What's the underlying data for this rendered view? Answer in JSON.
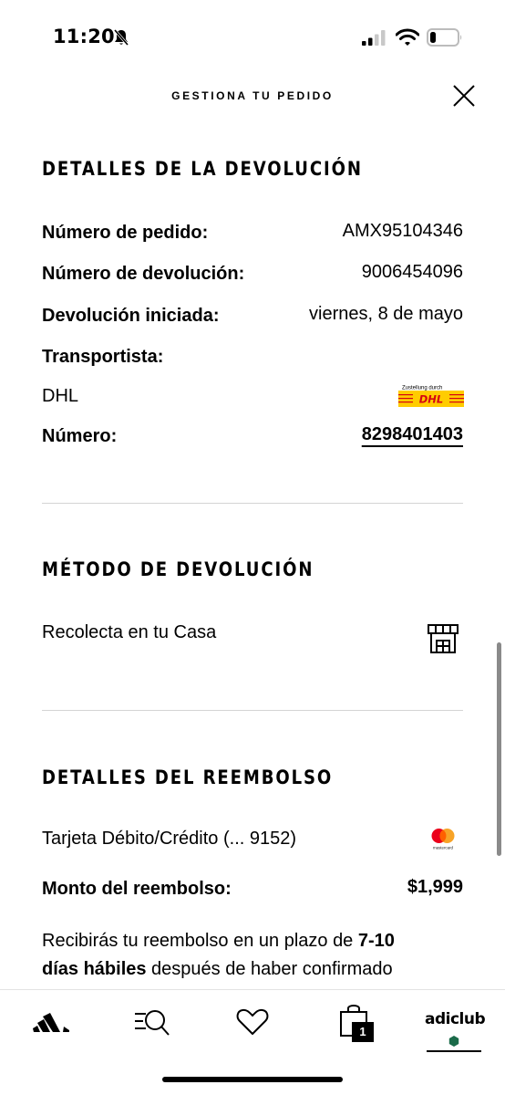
{
  "status_bar": {
    "time": "11:20",
    "icons": [
      "bell-slash-icon",
      "signal-icon",
      "wifi-icon",
      "battery-icon"
    ]
  },
  "header": {
    "title": "GESTIONA TU PEDIDO",
    "close_icon": "close-icon"
  },
  "return_details": {
    "title": "DETALLES DE LA DEVOLUCIÓN",
    "order_number_label": "Número de pedido:",
    "order_number_value": "AMX95104346",
    "return_number_label": "Número de devolución:",
    "return_number_value": "9006454096",
    "return_started_label": "Devolución iniciada:",
    "return_started_value": "viernes, 8 de mayo",
    "carrier_label": "Transportista:",
    "carrier_name": "DHL",
    "carrier_logo_text": "Zustellung durch",
    "carrier_logo_brand": "DHL",
    "tracking_label": "Número:",
    "tracking_value": "8298401403"
  },
  "return_method": {
    "title": "MÉTODO DE DEVOLUCIÓN",
    "method": "Recolecta en tu Casa",
    "icon": "store-icon"
  },
  "refund_details": {
    "title": "DETALLES DEL REEMBOLSO",
    "payment_method": "Tarjeta Débito/Crédito (... 9152)",
    "card_brand_text": "mastercard",
    "amount_label": "Monto del reembolso:",
    "amount_value": "$1,999",
    "note_prefix": "Recibirás tu reembolso en un plazo de ",
    "note_bold_1": "7-10",
    "note_bold_2": "días hábiles",
    "note_suffix": " después de haber confirmado"
  },
  "bottom_nav": {
    "items": [
      "adidas-logo-icon",
      "search-icon",
      "heart-icon",
      "bag-icon",
      "adiclub"
    ],
    "bag_count": "1",
    "adiclub_label": "adiclub"
  },
  "colors": {
    "dhl_yellow": "#FFCC00",
    "dhl_red": "#D40511",
    "mastercard_red": "#EB001B",
    "mastercard_orange": "#F79E1B",
    "adiclub_green": "#1B6B4A"
  }
}
